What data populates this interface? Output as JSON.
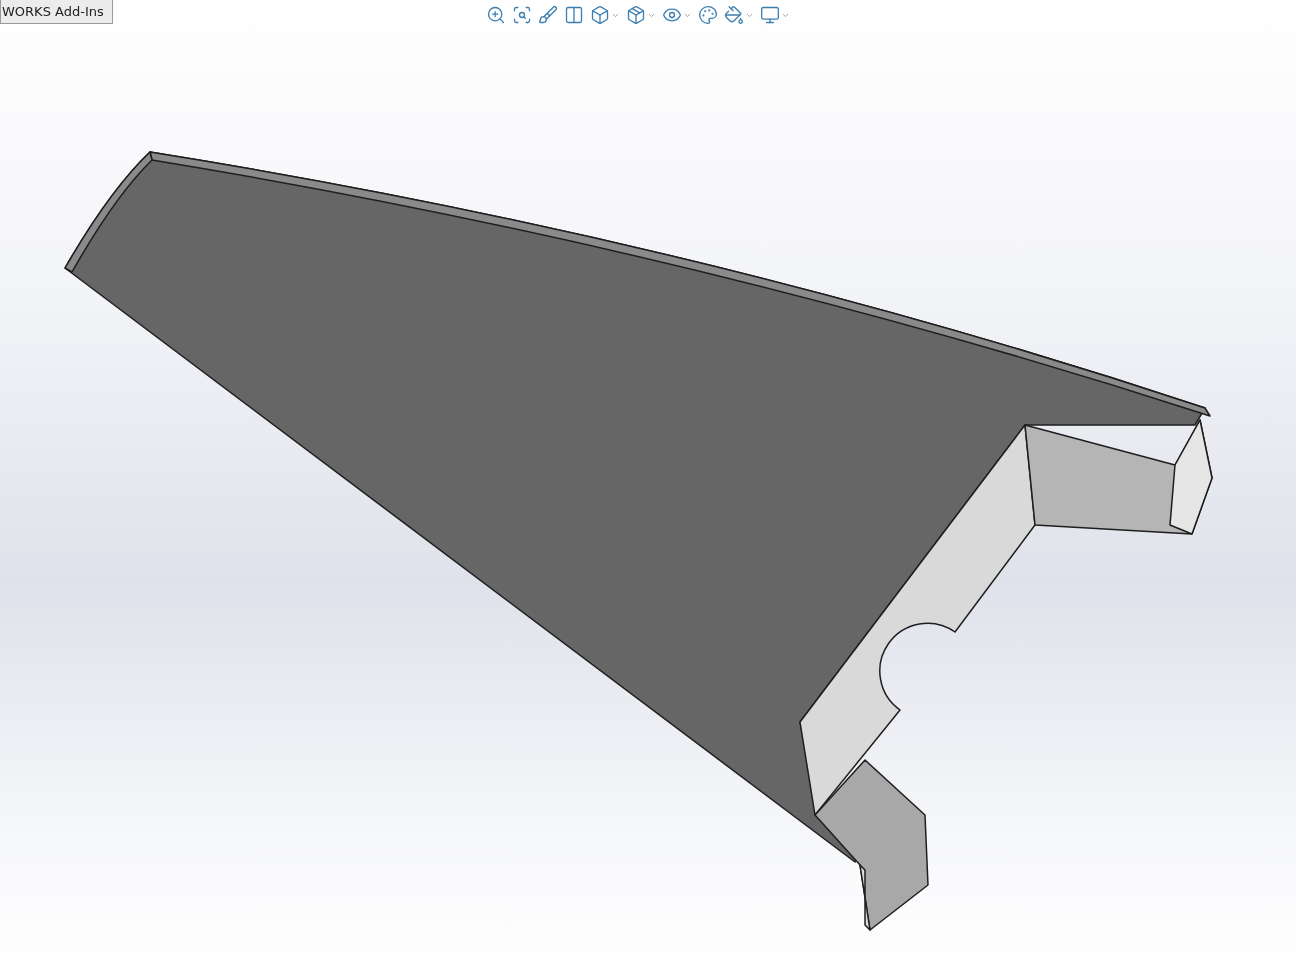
{
  "tab": {
    "label": "WORKS Add-Ins"
  },
  "view_toolbar": [
    {
      "dropdown": false
    },
    {
      "dropdown": false
    },
    {
      "dropdown": false
    },
    {
      "dropdown": false
    },
    {
      "dropdown": true
    },
    {
      "dropdown": true
    },
    {
      "dropdown": true
    },
    {
      "dropdown": false
    },
    {
      "dropdown": true
    },
    {
      "dropdown": true
    }
  ]
}
